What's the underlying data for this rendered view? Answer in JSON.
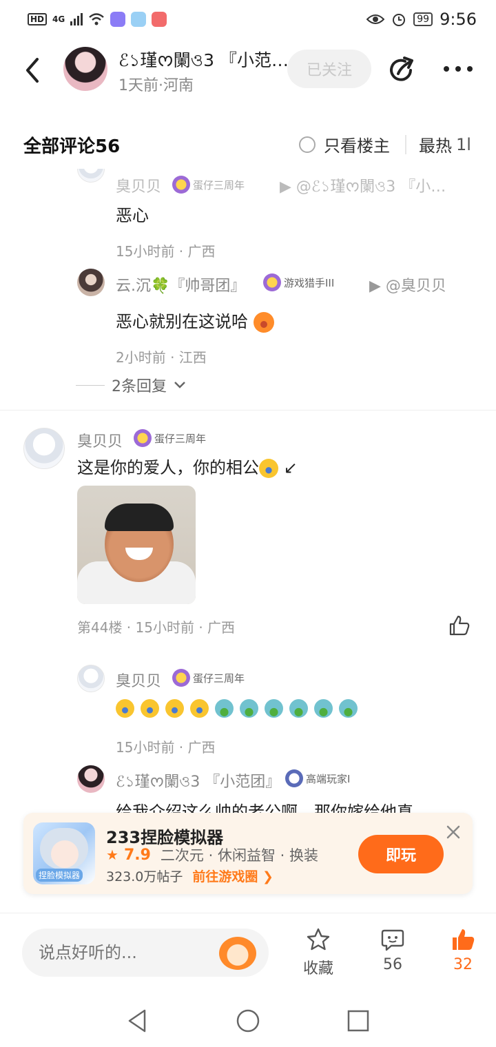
{
  "status_bar": {
    "network": "HD",
    "signal": "4G",
    "battery": "99",
    "time": "9:56"
  },
  "header": {
    "author_name": "ℰ১瑾ᰔ闌ও3 『小范…",
    "author_meta": "1天前·河南",
    "follow_label": "已关注"
  },
  "comments": {
    "title": "全部评论56",
    "only_op_label": "只看楼主",
    "sort_label": "最热",
    "sort_icon": "1l"
  },
  "feed": {
    "reply1": {
      "user": "臭贝贝",
      "badge": "蛋仔三周年",
      "reply_to": "▶ @ℰ১瑾ᰔ闌ও3 『小…",
      "text": "恶心",
      "meta": "15小时前 · 广西"
    },
    "reply2": {
      "user": "云.沉🍀『帅哥团』",
      "badge": "游戏猎手III",
      "reply_to": "▶ @臭贝贝",
      "text": "恶心就别在这说哈",
      "meta": "2小时前 · 江西"
    },
    "more_replies": "2条回复",
    "comment44": {
      "user": "臭贝贝",
      "badge": "蛋仔三周年",
      "text": "这是你的爱人，你的相公",
      "text_tail": "↙",
      "meta": "第44楼 · 15小时前 · 广西"
    },
    "reply3": {
      "user": "臭贝贝",
      "badge": "蛋仔三周年",
      "emojis": [
        "laugh",
        "laugh",
        "laugh",
        "laugh",
        "sick",
        "sick",
        "sick",
        "sick",
        "sick",
        "sick"
      ],
      "meta": "15小时前 · 广西"
    },
    "reply4": {
      "user": "ℰ১瑾ᰔ闌ও3 『小范团』",
      "badge": "高端玩家I",
      "text": "给我介绍这么帅的老公啊，那你嫁给他真"
    }
  },
  "ad": {
    "title": "233捏脸模拟器",
    "rating": "7.9",
    "tags": "二次元 · 休闲益智 · 换装",
    "posts": "323.0万帖子",
    "link": "前往游戏圈 ❯",
    "play_label": "即玩",
    "icon_tag": "捏脸模拟器"
  },
  "bottom_bar": {
    "input_placeholder": "说点好听的...",
    "favorite_label": "收藏",
    "comment_count": "56",
    "like_count": "32"
  },
  "colors": {
    "accent": "#ff6b1a",
    "muted": "#999999"
  }
}
